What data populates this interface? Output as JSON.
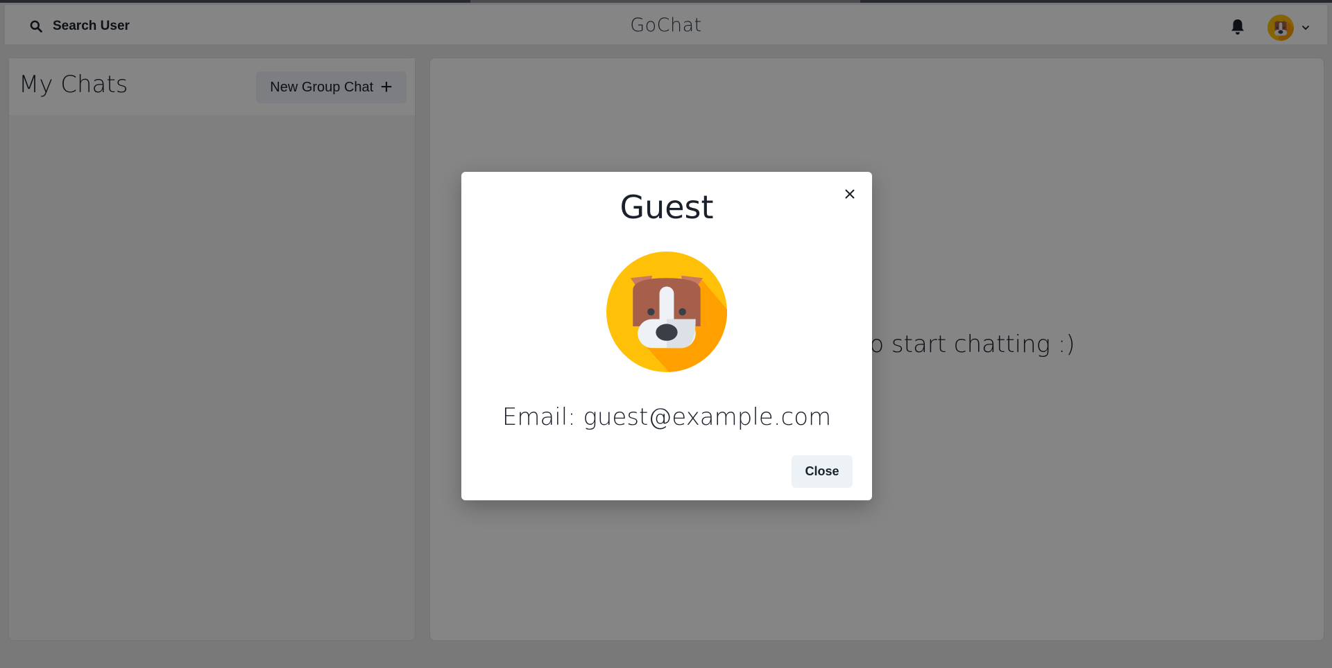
{
  "header": {
    "search_label": "Search User",
    "app_title": "GoChat"
  },
  "sidebar": {
    "title": "My Chats",
    "new_group_label": "New Group Chat",
    "new_group_icon": "plus-icon"
  },
  "main": {
    "empty_state_text": "Click on a user to start chatting :)"
  },
  "modal": {
    "title": "Guest",
    "email_text": "Email: guest@example.com",
    "close_label": "Close",
    "avatar_icon": "dog-avatar"
  },
  "colors": {
    "avatar_bg": "#FFC107",
    "avatar_shadow": "#FFA000",
    "dog_brown": "#A65F4B",
    "dog_white": "#EEF1F5"
  }
}
